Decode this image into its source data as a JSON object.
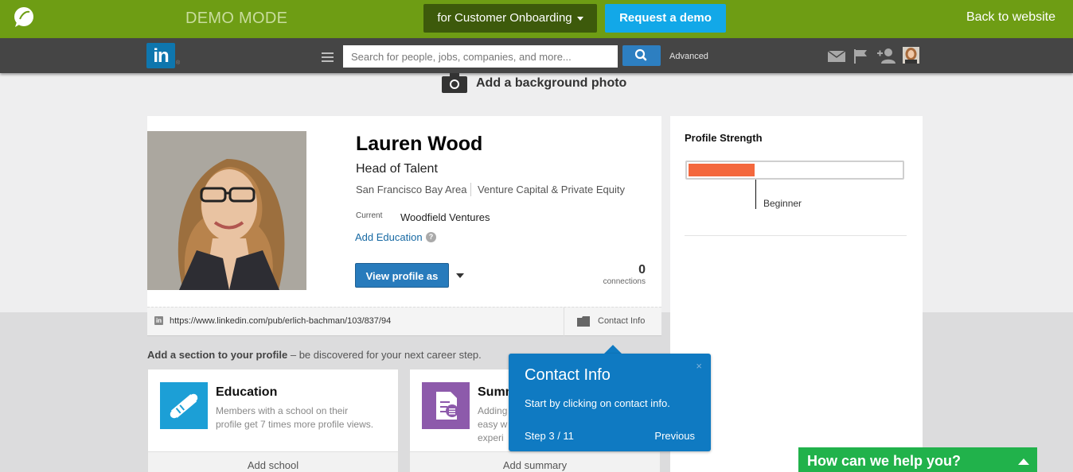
{
  "demo_bar": {
    "mode_label": "DEMO MODE",
    "dropdown_label": "for Customer Onboarding",
    "request_label": "Request a demo",
    "back_label": "Back to website",
    "bg_color": "#6e9d14"
  },
  "nav": {
    "logo_text": "in",
    "logo_reg": "®",
    "search_placeholder": "Search for people, jobs, companies, and more...",
    "advanced_label": "Advanced",
    "icons": [
      "menu-icon",
      "search-icon",
      "mail-icon",
      "flag-icon",
      "add-connection-icon",
      "avatar"
    ]
  },
  "background_photo": {
    "label": "Add a background photo"
  },
  "profile": {
    "name": "Lauren Wood",
    "headline": "Head of Talent",
    "location": "San Francisco Bay Area",
    "industry": "Venture Capital & Private Equity",
    "current_label": "Current",
    "current_value": "Woodfield Ventures",
    "add_education": "Add Education",
    "help_glyph": "?",
    "view_profile_label": "View profile as",
    "connections_count": "0",
    "connections_label": "connections",
    "public_url": "https://www.linkedin.com/pub/erlich-bachman/103/837/94",
    "url_icon_text": "in",
    "contact_info_label": "Contact Info"
  },
  "profile_strength": {
    "title": "Profile Strength",
    "level": "Beginner",
    "fill_fraction": 0.31,
    "fill_color": "#f4683d"
  },
  "add_section": {
    "bold": "Add a section to your profile",
    "rest": " – be discovered for your next career step."
  },
  "section_cards": [
    {
      "title": "Education",
      "description": "Members with a school on their profile get 7 times more profile views.",
      "action": "Add school",
      "icon_color": "#1c9fd6"
    },
    {
      "title": "Summ",
      "description": "Adding\neasy w\nexperi",
      "action": "Add summary",
      "icon_color": "#8d5aab"
    }
  ],
  "tooltip": {
    "title": "Contact Info",
    "body": "Start by clicking on contact info.",
    "step": "Step 3 / 11",
    "previous": "Previous",
    "close_glyph": "×"
  },
  "help_widget": {
    "label": "How can we help you?"
  }
}
